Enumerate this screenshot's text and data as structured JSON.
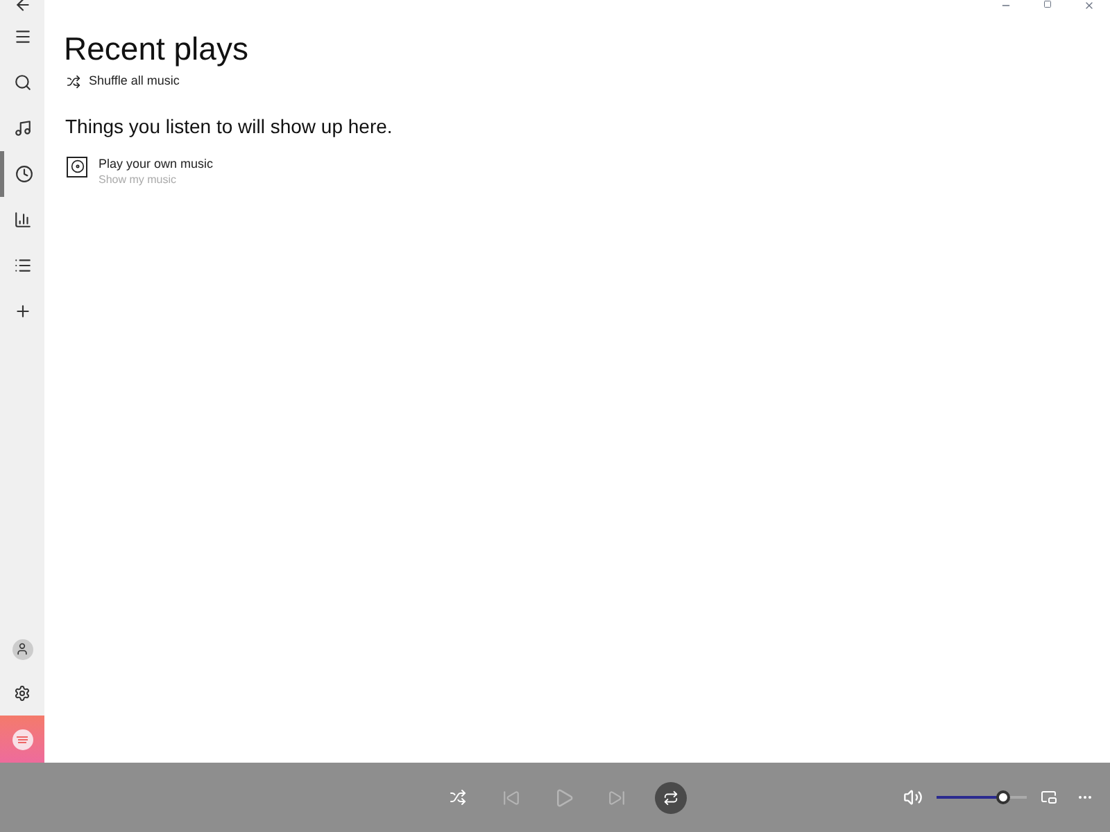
{
  "nav": {
    "items": [
      {
        "kind": "back",
        "selected": false
      },
      {
        "kind": "menu",
        "selected": false
      },
      {
        "kind": "search",
        "selected": false
      },
      {
        "kind": "music",
        "selected": false
      },
      {
        "kind": "recent",
        "selected": true
      },
      {
        "kind": "charts",
        "selected": false
      },
      {
        "kind": "playlists",
        "selected": false
      },
      {
        "kind": "add",
        "selected": false
      }
    ],
    "bottom": [
      {
        "kind": "account"
      },
      {
        "kind": "settings"
      },
      {
        "kind": "app"
      }
    ]
  },
  "page": {
    "title": "Recent plays",
    "shuffle": "Shuffle all music",
    "empty_message": "Things you listen to will show up here.",
    "suggestion": {
      "title": "Play your own music",
      "subtitle": "Show my music"
    }
  },
  "player": {
    "repeat_on": true,
    "volume": {
      "level": 0.74
    }
  }
}
